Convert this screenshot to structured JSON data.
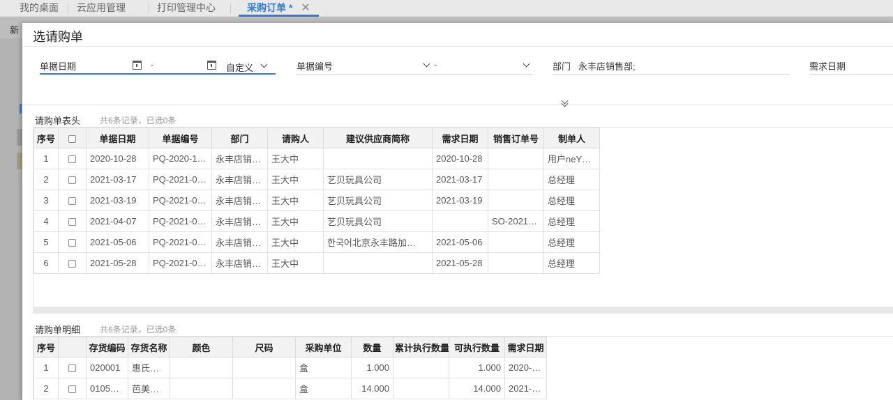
{
  "tabs": [
    {
      "label": "我的桌面",
      "active": false
    },
    {
      "label": "云应用管理",
      "active": false
    },
    {
      "label": "打印管理中心",
      "active": false
    },
    {
      "label": "采购订单 *",
      "active": true
    }
  ],
  "background": {
    "new_label": "新"
  },
  "modal": {
    "title": "选请购单",
    "filters": {
      "date_label": "单据日期",
      "date_sep": "-",
      "date_mode": "自定义",
      "docno_label": "单据编号",
      "docno_sep": "-",
      "dept_label": "部门",
      "dept_value": "永丰店销售部;",
      "need_date_label": "需求日期"
    },
    "header_section": {
      "title": "请购单表头",
      "count": "共6条记录，已选0条"
    },
    "detail_section": {
      "title": "请购单明细",
      "count": "共6条记录，已选0条"
    }
  },
  "header_table": {
    "columns": [
      "序号",
      "",
      "单据日期",
      "单据编号",
      "部门",
      "请购人",
      "建议供应商简称",
      "需求日期",
      "销售订单号",
      "制单人"
    ],
    "rows": [
      {
        "no": "1",
        "date": "2020-10-28",
        "docno": "PQ-2020-1…",
        "dept": "永丰店销…",
        "requester": "王大中",
        "supplier": "",
        "need_date": "2020-10-28",
        "so": "",
        "maker": "用户neY…"
      },
      {
        "no": "2",
        "date": "2021-03-17",
        "docno": "PQ-2021-0…",
        "dept": "永丰店销…",
        "requester": "王大中",
        "supplier": "艺贝玩具公司",
        "need_date": "2021-03-17",
        "so": "",
        "maker": "总经理"
      },
      {
        "no": "3",
        "date": "2021-03-19",
        "docno": "PQ-2021-0…",
        "dept": "永丰店销…",
        "requester": "王大中",
        "supplier": "艺贝玩具公司",
        "need_date": "2021-03-19",
        "so": "",
        "maker": "总经理"
      },
      {
        "no": "4",
        "date": "2021-04-07",
        "docno": "PQ-2021-0…",
        "dept": "永丰店销…",
        "requester": "王大中",
        "supplier": "艺贝玩具公司",
        "need_date": "",
        "so": "SO-2021…",
        "maker": "总经理"
      },
      {
        "no": "5",
        "date": "2021-05-06",
        "docno": "PQ-2021-0…",
        "dept": "永丰店销…",
        "requester": "王大中",
        "supplier": "한국어北京永丰路加…",
        "need_date": "2021-05-06",
        "so": "",
        "maker": "总经理"
      },
      {
        "no": "6",
        "date": "2021-05-28",
        "docno": "PQ-2021-0…",
        "dept": "永丰店销…",
        "requester": "王大中",
        "supplier": "",
        "need_date": "2021-05-28",
        "so": "",
        "maker": "总经理"
      }
    ]
  },
  "detail_table": {
    "columns": [
      "序号",
      "",
      "存货编码",
      "存货名称",
      "颜色",
      "尺码",
      "采购单位",
      "数量",
      "累计执行数量",
      "可执行数量",
      "需求日期"
    ],
    "rows": [
      {
        "no": "1",
        "code": "020001",
        "name": "惠氏…",
        "color": "",
        "size": "",
        "unit": "盒",
        "qty": "1.000",
        "executed": "",
        "executable": "1.000",
        "need_date": "2020-…"
      },
      {
        "no": "2",
        "code": "0105…",
        "name": "芭美…",
        "color": "",
        "size": "",
        "unit": "盒",
        "qty": "14.000",
        "executed": "",
        "executable": "14.000",
        "need_date": "2021-…"
      }
    ]
  }
}
